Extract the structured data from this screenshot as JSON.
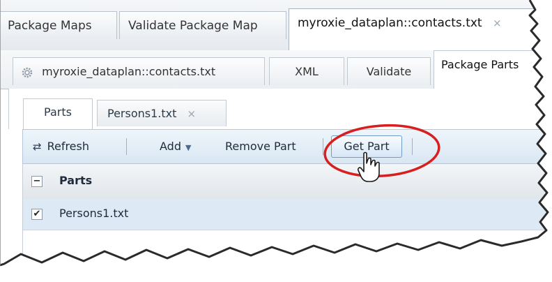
{
  "tabs_level1": [
    {
      "label": "Package Maps",
      "active": false
    },
    {
      "label": "Validate Package Map",
      "active": false
    },
    {
      "label": "myroxie_dataplan::contacts.txt",
      "active": true,
      "closable": true
    }
  ],
  "tabs_level2": [
    {
      "label": "myroxie_dataplan::contacts.txt",
      "icon": "gear-icon",
      "active": false
    },
    {
      "label": "XML",
      "active": false
    },
    {
      "label": "Validate",
      "active": false
    },
    {
      "label": "Package Parts",
      "active": true
    }
  ],
  "tabs_level3": [
    {
      "label": "Parts",
      "active": true
    },
    {
      "label": "Persons1.txt",
      "active": false,
      "closable": true
    }
  ],
  "toolbar": {
    "refresh_label": "Refresh",
    "add_label": "Add",
    "remove_label": "Remove Part",
    "get_label": "Get Part"
  },
  "grid": {
    "header": "Parts",
    "rows": [
      {
        "name": "Persons1.txt",
        "checked": true
      }
    ]
  },
  "icons": {
    "close": "×",
    "refresh": "⇄",
    "check": "✔",
    "collapse": "−",
    "caret": "▼"
  },
  "colors": {
    "highlight_ring": "#d81f1f",
    "selected_row": "#dde9f5",
    "toolbar": "#d9e7f3"
  }
}
